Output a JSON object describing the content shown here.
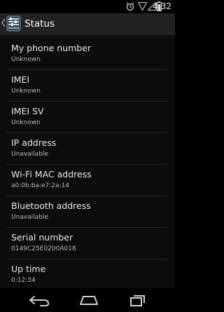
{
  "status_bar": {
    "time": "4:32",
    "icons": [
      "alarm-icon",
      "wifi-icon",
      "signal-icon",
      "battery-icon"
    ]
  },
  "action_bar": {
    "title": "Status",
    "icon": "settings-icon",
    "up_icon": "chevron-left-icon"
  },
  "items": [
    {
      "title": "My phone number",
      "value": "Unknown"
    },
    {
      "title": "IMEI",
      "value": "Unknown"
    },
    {
      "title": "IMEI SV",
      "value": "Unknown"
    },
    {
      "title": "IP address",
      "value": "Unavailable"
    },
    {
      "title": "Wi-Fi MAC address",
      "value": "a0:0b:ba:e7:2a:14"
    },
    {
      "title": "Bluetooth address",
      "value": "Unavailable"
    },
    {
      "title": "Serial number",
      "value": "0149C25E0200A018"
    },
    {
      "title": "Up time",
      "value": "0:12:34"
    }
  ],
  "nav_bar": {
    "buttons": [
      "back-icon",
      "home-icon",
      "recent-apps-icon"
    ]
  },
  "colors": {
    "background": "#0c0c0c",
    "action_bar": "#222222",
    "divider": "#2a2a2a"
  }
}
